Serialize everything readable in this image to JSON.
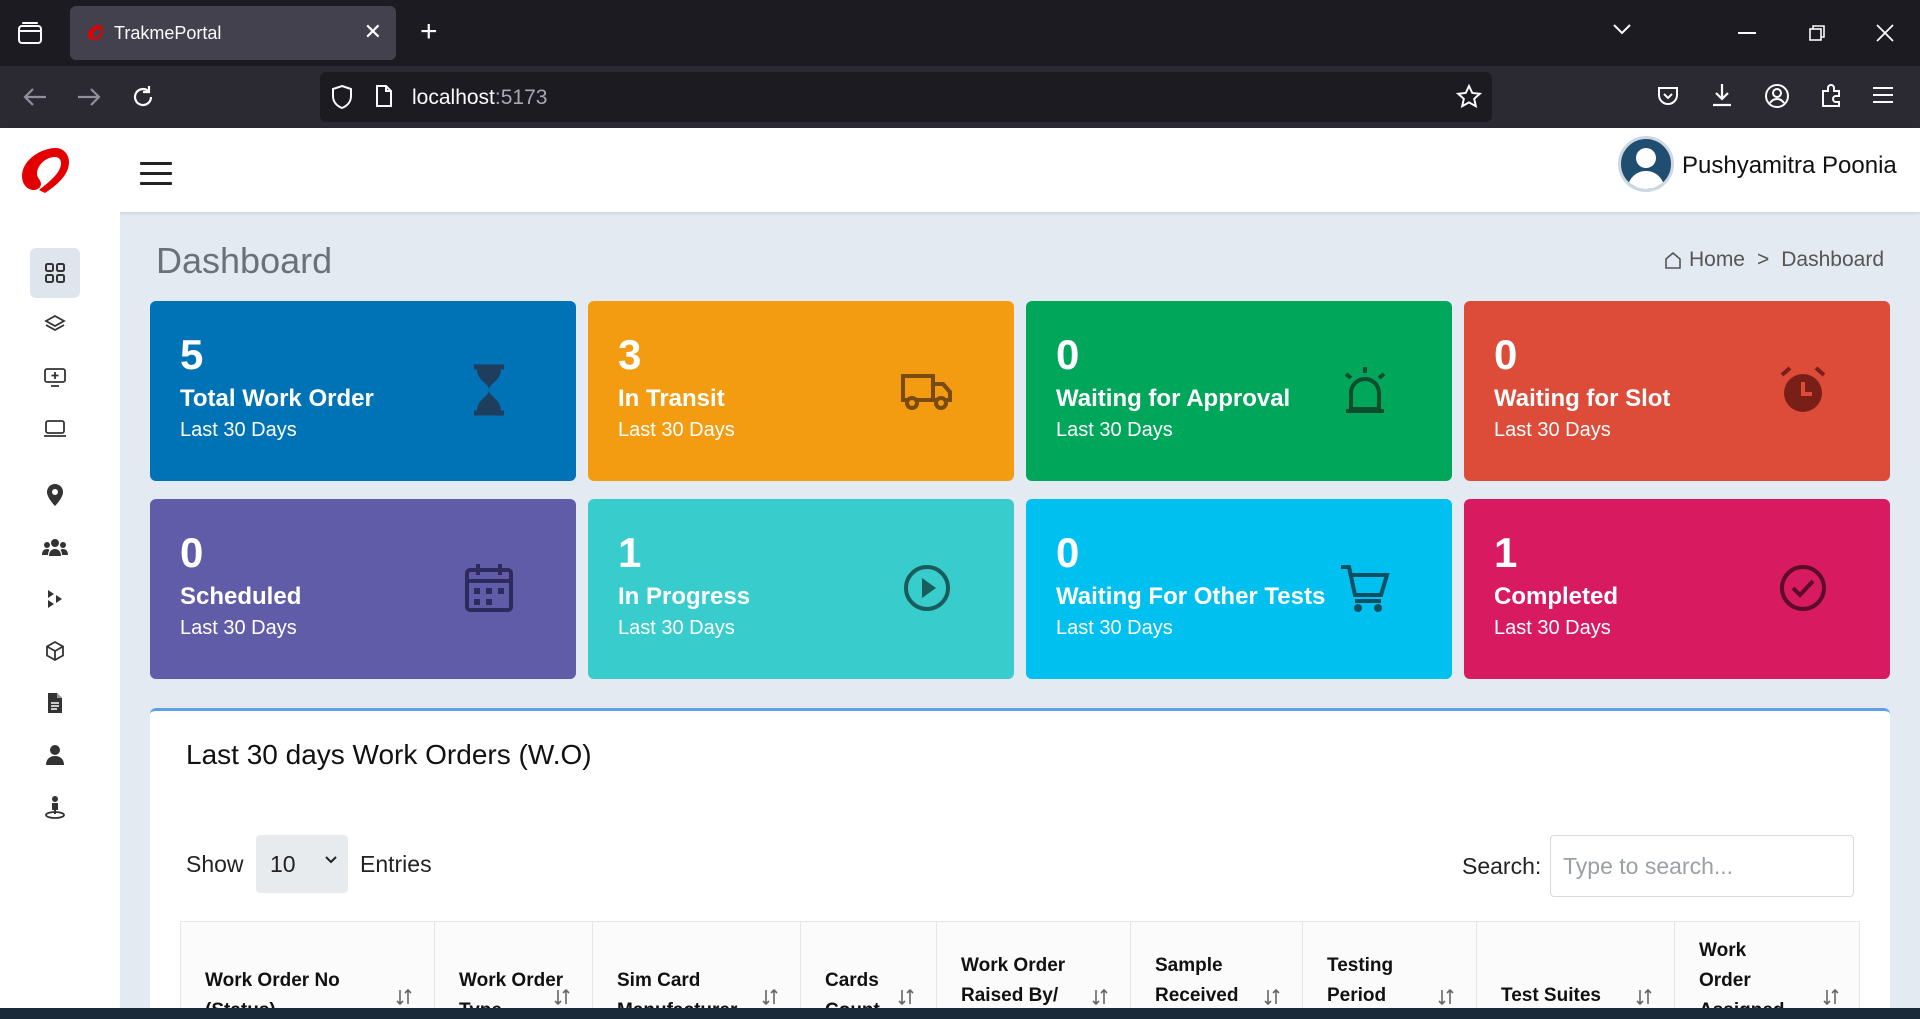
{
  "browser": {
    "tab_title": "TrakmePortal",
    "url_host": "localhost",
    "url_port": ":5173"
  },
  "header": {
    "user_name": "Pushyamitra Poonia"
  },
  "sidebar": {
    "items": [
      {
        "icon": "dashboard-grid-icon"
      },
      {
        "icon": "layers-icon"
      },
      {
        "icon": "add-monitor-icon"
      },
      {
        "icon": "laptop-icon"
      },
      {
        "icon": "location-pin-icon"
      },
      {
        "icon": "users-group-icon"
      },
      {
        "icon": "arrows-icon"
      },
      {
        "icon": "cube-icon"
      },
      {
        "icon": "document-icon"
      },
      {
        "icon": "user-icon"
      },
      {
        "icon": "person-location-icon"
      }
    ]
  },
  "page": {
    "title": "Dashboard",
    "breadcrumb_home": "Home",
    "breadcrumb_sep": ">",
    "breadcrumb_current": "Dashboard"
  },
  "cards": [
    {
      "count": "5",
      "label": "Total Work Order",
      "sub": "Last 30 Days",
      "color": "#0073b7",
      "icon": "hourglass-icon"
    },
    {
      "count": "3",
      "label": "In Transit",
      "sub": "Last 30 Days",
      "color": "#f39c12",
      "icon": "truck-icon"
    },
    {
      "count": "0",
      "label": "Waiting for Approval",
      "sub": "Last 30 Days",
      "color": "#00a65a",
      "icon": "alarm-light-icon"
    },
    {
      "count": "0",
      "label": "Waiting for Slot",
      "sub": "Last 30 Days",
      "color": "#dd4b39",
      "icon": "alarm-clock-icon"
    },
    {
      "count": "0",
      "label": "Scheduled",
      "sub": "Last 30 Days",
      "color": "#605ca8",
      "icon": "calendar-icon"
    },
    {
      "count": "1",
      "label": "In Progress",
      "sub": "Last 30 Days",
      "color": "#39cccc",
      "icon": "play-circle-icon"
    },
    {
      "count": "0",
      "label": "Waiting For Other Tests",
      "sub": "Last 30 Days",
      "color": "#00c0ef",
      "icon": "cart-icon"
    },
    {
      "count": "1",
      "label": "Completed",
      "sub": "Last 30 Days",
      "color": "#d81b60",
      "icon": "check-circle-icon"
    }
  ],
  "work_orders": {
    "title": "Last 30 days Work Orders (W.O)",
    "show_label": "Show",
    "page_size": "10",
    "entries_label": "Entries",
    "search_label": "Search:",
    "search_placeholder": "Type to search...",
    "columns": [
      {
        "l1": "Work Order No",
        "l2": "(Status)"
      },
      {
        "l1": "Work Order",
        "l2": "Type"
      },
      {
        "l1": "Sim Card",
        "l2": "Manufacturer"
      },
      {
        "l1": "Cards",
        "l2": "Count"
      },
      {
        "l1": "Work Order",
        "l2": "Raised By/"
      },
      {
        "l1": "Sample",
        "l2": "Received"
      },
      {
        "l1": "Testing",
        "l2": "Period"
      },
      {
        "l1": "Test Suites",
        "l2": ""
      },
      {
        "l1": "Work",
        "l2": "Order",
        "l3": "Assigned"
      }
    ]
  }
}
